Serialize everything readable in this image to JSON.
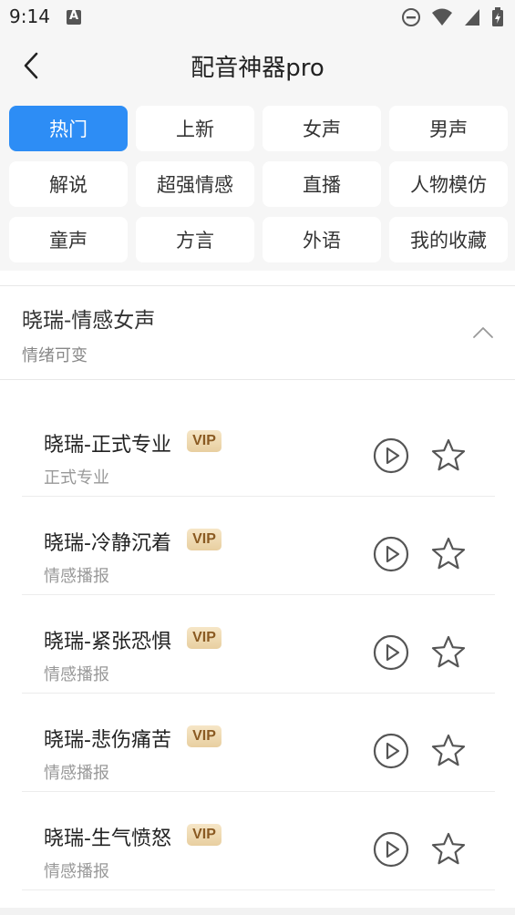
{
  "status": {
    "time": "9:14"
  },
  "header": {
    "title": "配音神器pro"
  },
  "categories": [
    {
      "label": "热门",
      "active": true
    },
    {
      "label": "上新"
    },
    {
      "label": "女声"
    },
    {
      "label": "男声"
    },
    {
      "label": "解说"
    },
    {
      "label": "超强情感"
    },
    {
      "label": "直播"
    },
    {
      "label": "人物模仿"
    },
    {
      "label": "童声"
    },
    {
      "label": "方言"
    },
    {
      "label": "外语"
    },
    {
      "label": "我的收藏"
    }
  ],
  "group": {
    "title": "晓瑞-情感女声",
    "subtitle": "情绪可变"
  },
  "items": [
    {
      "title": "晓瑞-正式专业",
      "badge": "VIP",
      "subtitle": "正式专业"
    },
    {
      "title": "晓瑞-冷静沉着",
      "badge": "VIP",
      "subtitle": "情感播报"
    },
    {
      "title": "晓瑞-紧张恐惧",
      "badge": "VIP",
      "subtitle": "情感播报"
    },
    {
      "title": "晓瑞-悲伤痛苦",
      "badge": "VIP",
      "subtitle": "情感播报"
    },
    {
      "title": "晓瑞-生气愤怒",
      "badge": "VIP",
      "subtitle": "情感播报"
    }
  ],
  "colors": {
    "accent": "#2d8df5",
    "vip_text": "#8a5a22"
  }
}
